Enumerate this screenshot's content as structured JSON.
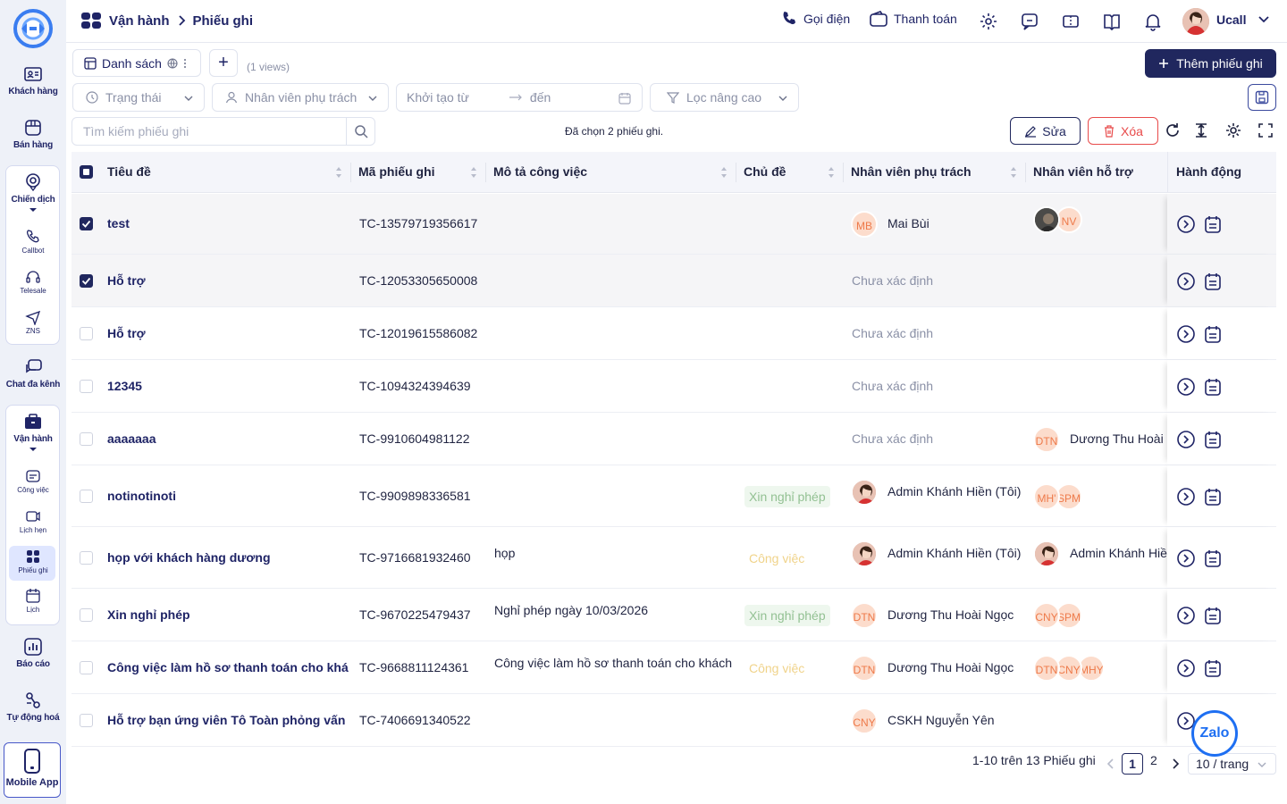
{
  "sidebar": {
    "items": [
      {
        "label": "Khách hàng",
        "icon": "contact-card-icon"
      },
      {
        "label": "Bán hàng",
        "icon": "store-icon"
      },
      {
        "label": "Chiến dịch",
        "icon": "target-icon"
      },
      {
        "label": "Chat đa kênh",
        "icon": "chat-bubbles-icon"
      },
      {
        "label": "Vận hành",
        "icon": "briefcase-icon"
      },
      {
        "label": "Báo cáo",
        "icon": "chart-icon"
      },
      {
        "label": "Tự động hoá",
        "icon": "automation-icon"
      },
      {
        "label": "Mobile App",
        "icon": "mobile-icon"
      }
    ],
    "campaign_sub": [
      {
        "label": "Callbot",
        "icon": "phone-icon"
      },
      {
        "label": "Telesale",
        "icon": "headset-icon"
      },
      {
        "label": "ZNS",
        "icon": "send-icon"
      }
    ],
    "ops_sub": [
      {
        "label": "Công việc",
        "icon": "task-icon"
      },
      {
        "label": "Lịch hẹn",
        "icon": "appointment-icon"
      },
      {
        "label": "Phiếu ghi",
        "icon": "ticket-icon"
      },
      {
        "label": "Lịch",
        "icon": "calendar-icon"
      }
    ]
  },
  "header": {
    "breadcrumb": [
      "Vận hành",
      "Phiếu ghi"
    ],
    "call_label": "Gọi điện",
    "payment_label": "Thanh toán",
    "user_name": "Ucall"
  },
  "toolbar": {
    "view_tab": "Danh sách",
    "views_count": "(1 views)",
    "add_button": "Thêm phiếu ghi",
    "edit_button": "Sửa",
    "delete_button": "Xóa",
    "selected_info": "Đã chọn 2 phiếu ghi."
  },
  "filters": {
    "status": "Trạng thái",
    "assignee": "Nhân viên phụ trách",
    "created_from": "Khởi tạo từ",
    "created_to": "đến",
    "advanced": "Lọc nâng cao",
    "search_placeholder": "Tìm kiếm phiếu ghi"
  },
  "table": {
    "columns": [
      "Tiêu đề",
      "Mã phiếu ghi",
      "Mô tả công việc",
      "Chủ đề",
      "Nhân viên phụ trách",
      "Nhân viên hỗ trợ",
      "Hành động"
    ],
    "rows": [
      {
        "title": "test",
        "code": "TC-13579719356617",
        "desc": "",
        "topic": "",
        "topic_type": "",
        "assignee": "Mai Bùi",
        "assignee_initials": "MB",
        "support": "",
        "support_avatars": [
          "",
          "NV"
        ],
        "checked": true
      },
      {
        "title": "Hỗ trợ",
        "code": "TC-12053305650008",
        "desc": "",
        "topic": "",
        "topic_type": "",
        "assignee": "Chưa xác định",
        "assignee_initials": "",
        "support": "",
        "support_avatars": [],
        "checked": true
      },
      {
        "title": "Hỗ trợ",
        "code": "TC-12019615586082",
        "desc": "",
        "topic": "",
        "topic_type": "",
        "assignee": "Chưa xác định",
        "assignee_initials": "",
        "support": "",
        "support_avatars": [],
        "checked": false
      },
      {
        "title": "12345",
        "code": "TC-1094324394639",
        "desc": "",
        "topic": "",
        "topic_type": "",
        "assignee": "Chưa xác định",
        "assignee_initials": "",
        "support": "",
        "support_avatars": [],
        "checked": false
      },
      {
        "title": "aaaaaaa",
        "code": "TC-9910604981122",
        "desc": "",
        "topic": "",
        "topic_type": "",
        "assignee": "Chưa xác định",
        "assignee_initials": "",
        "support": "Dương Thu Hoài N",
        "support_avatars": [
          "DTN"
        ],
        "checked": false
      },
      {
        "title": "notinotinoti",
        "code": "TC-9909898336581",
        "desc": "",
        "topic": "Xin nghỉ phép",
        "topic_type": "leave",
        "assignee": "Admin Khánh Hiền (Tôi)",
        "assignee_initials": "",
        "support": "",
        "support_avatars": [
          "MH'",
          "SPM"
        ],
        "checked": false
      },
      {
        "title": "họp với khách hàng dương",
        "code": "TC-9716681932460",
        "desc": "họp",
        "topic": "Công việc",
        "topic_type": "work",
        "assignee": "Admin Khánh Hiền (Tôi)",
        "assignee_initials": "",
        "support": "Admin Khánh Hiền",
        "support_avatars": [
          ""
        ],
        "checked": false
      },
      {
        "title": "Xin nghỉ phép",
        "code": "TC-9670225479437",
        "desc": "Nghỉ phép ngày 10/03/2026",
        "topic": "Xin nghỉ phép",
        "topic_type": "leave",
        "assignee": "Dương Thu Hoài Ngọc",
        "assignee_initials": "DTN",
        "support": "",
        "support_avatars": [
          "CNY",
          "SPM"
        ],
        "checked": false
      },
      {
        "title": "Công việc làm hồ sơ thanh toán cho khách",
        "code": "TC-9668811124361",
        "desc": "Công việc làm hồ sơ thanh toán cho khách",
        "topic": "Công việc",
        "topic_type": "work",
        "assignee": "Dương Thu Hoài Ngọc",
        "assignee_initials": "DTN",
        "support": "",
        "support_avatars": [
          "DTN",
          "CNY",
          "MHY"
        ],
        "checked": false
      },
      {
        "title": "Hỗ trợ bạn ứng viên Tô Toàn phỏng vấn",
        "code": "TC-7406691340522",
        "desc": "",
        "topic": "",
        "topic_type": "",
        "assignee": "CSKH Nguyễn Yên",
        "assignee_initials": "CNY",
        "support": "",
        "support_avatars": [],
        "checked": false
      }
    ]
  },
  "pagination": {
    "summary": "1-10 trên 13 Phiếu ghi",
    "current": "1",
    "next": "2",
    "page_size": "10 / trang"
  },
  "chat_widget": "Zalo"
}
